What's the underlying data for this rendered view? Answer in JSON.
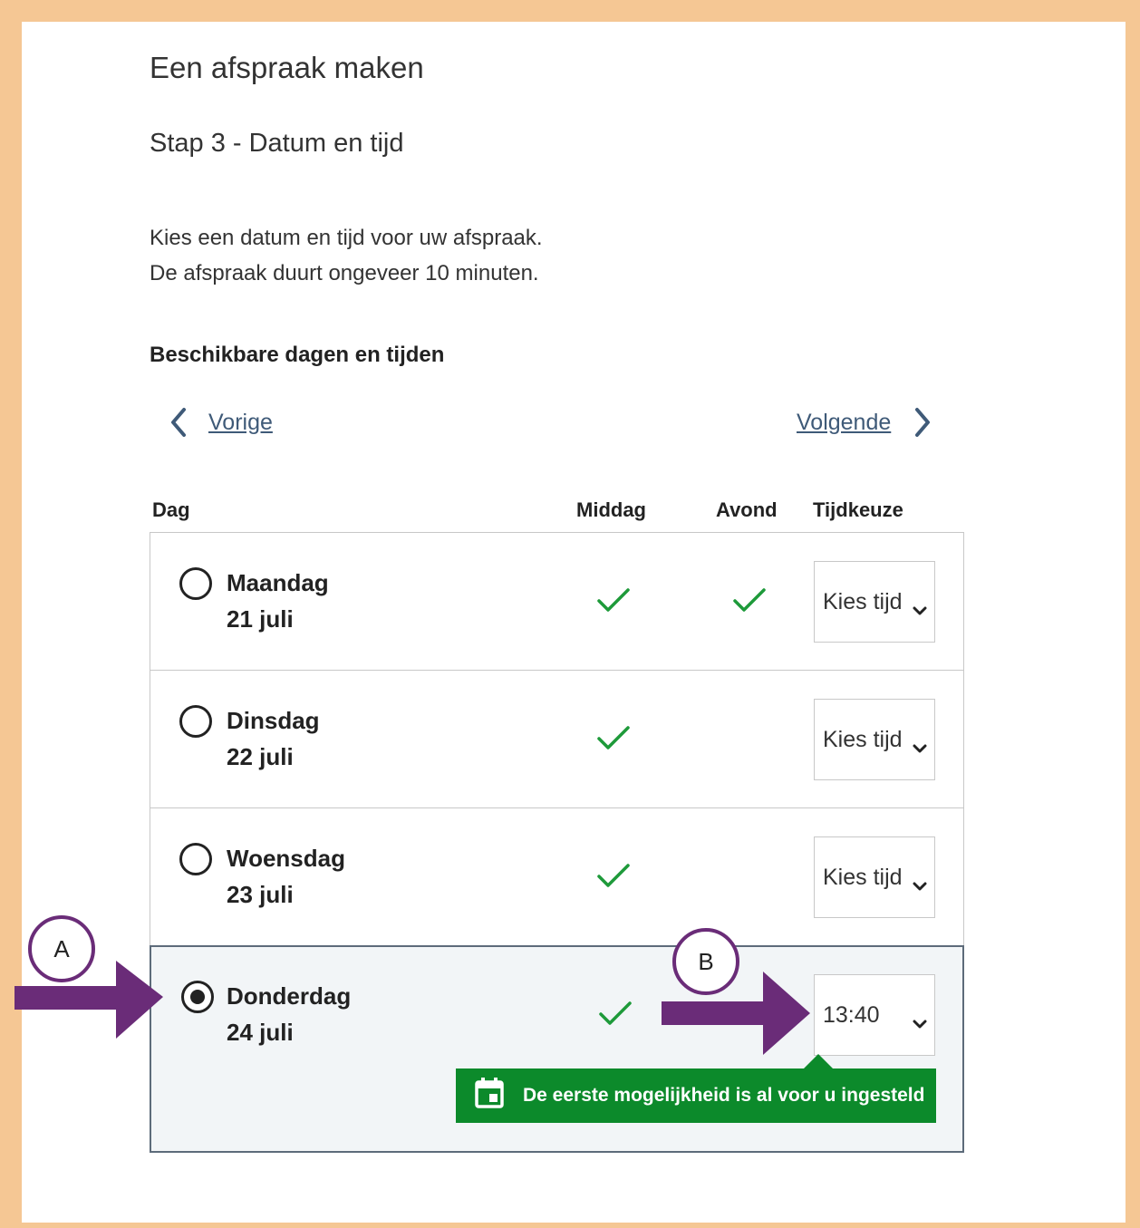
{
  "header": {
    "title": "Een afspraak maken",
    "step": "Stap 3 - Datum en tijd"
  },
  "intro": {
    "line1": "Kies een datum en tijd voor uw afspraak.",
    "line2": "De afspraak duurt ongeveer 10 minuten."
  },
  "section_title": "Beschikbare dagen en tijden",
  "nav": {
    "previous": "Vorige",
    "next": "Volgende"
  },
  "columns": {
    "day": "Dag",
    "afternoon": "Middag",
    "evening": "Avond",
    "time": "Tijdkeuze"
  },
  "days": [
    {
      "name": "Maandag",
      "date": "21 juli",
      "selected": false,
      "afternoon": true,
      "evening": true,
      "time": "Kies tijd"
    },
    {
      "name": "Dinsdag",
      "date": "22 juli",
      "selected": false,
      "afternoon": true,
      "evening": false,
      "time": "Kies tijd"
    },
    {
      "name": "Woensdag",
      "date": "23 juli",
      "selected": false,
      "afternoon": true,
      "evening": false,
      "time": "Kies tijd"
    },
    {
      "name": "Donderdag",
      "date": "24 juli",
      "selected": true,
      "afternoon": true,
      "evening": false,
      "time": "13:40"
    }
  ],
  "notice": "De eerste mogelijkheid is al voor u ingesteld",
  "annotations": {
    "marker_a": "A",
    "marker_b": "B"
  },
  "icons": {
    "prev": "chevron-left-icon",
    "next": "chevron-right-icon",
    "available": "checkmark-icon",
    "dropdown": "chevron-down-icon",
    "notice": "calendar-icon"
  },
  "colors": {
    "frame": "#f5c794",
    "link": "#3f5a78",
    "check": "#1e9a3a",
    "notice_bg": "#0c8a2b",
    "annotation": "#6a2c78",
    "selected_row_bg": "#f2f5f7"
  }
}
